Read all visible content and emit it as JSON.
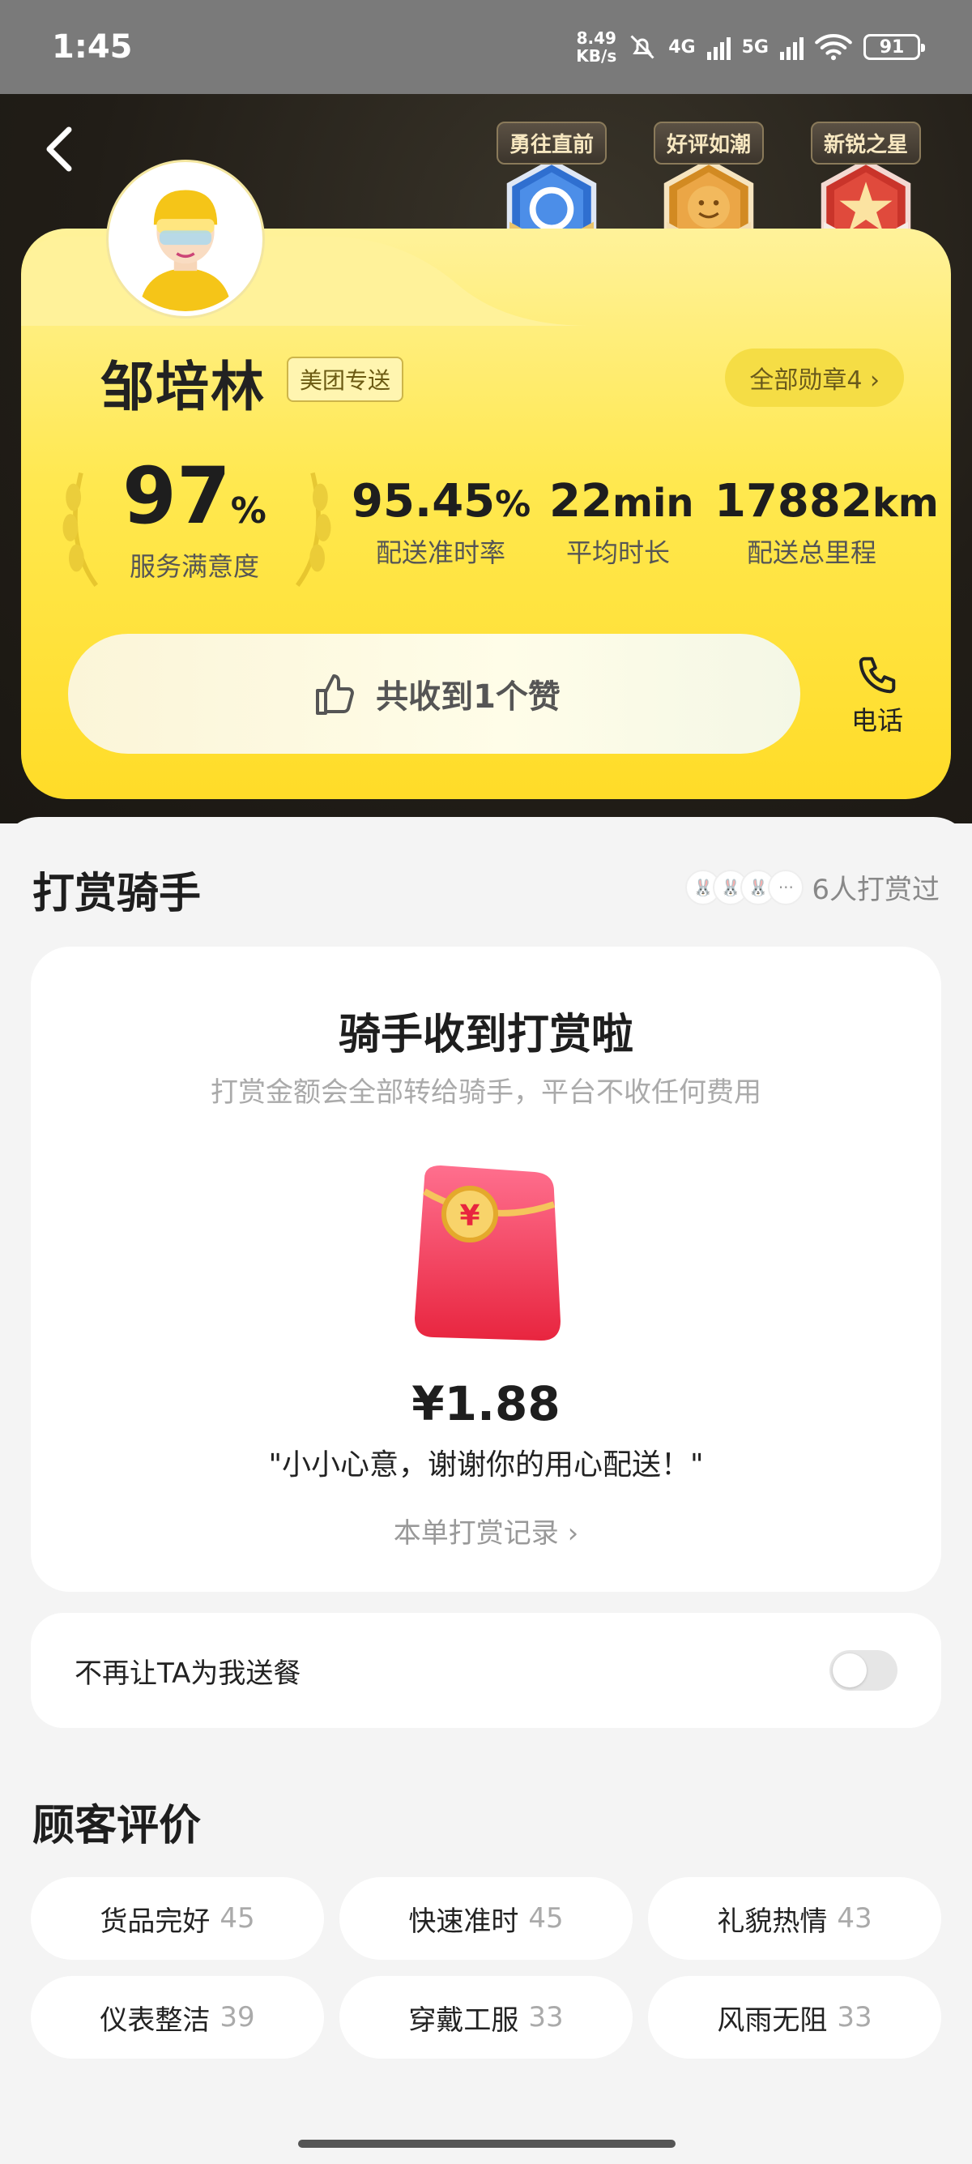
{
  "status_bar": {
    "time": "1:45",
    "speed_top": "8.49",
    "speed_bottom": "KB/s",
    "net1": "4G",
    "net2": "5G",
    "battery": "91"
  },
  "header": {
    "badges": [
      {
        "label": "勇往直前",
        "color": "#3f7fd6"
      },
      {
        "label": "好评如潮",
        "color": "#e5a83a"
      },
      {
        "label": "新锐之星",
        "color": "#d9463a"
      }
    ],
    "rider_name": "邹培林",
    "service_tag": "美团专送",
    "all_badges": "全部勋章4 ›"
  },
  "stats": [
    {
      "value": "97",
      "unit": "%",
      "label": "服务满意度"
    },
    {
      "value": "95.45",
      "unit": "%",
      "label": "配送准时率"
    },
    {
      "value": "22",
      "unit": "min",
      "label": "平均时长"
    },
    {
      "value": "17882",
      "unit": "km",
      "label": "配送总里程"
    }
  ],
  "likes": {
    "text": "共收到1个赞"
  },
  "phone": {
    "label": "电话"
  },
  "tip_section": {
    "title": "打赏骑手",
    "tippers_text": "6人打赏过",
    "card_title": "骑手收到打赏啦",
    "card_sub": "打赏金额会全部转给骑手，平台不收任何费用",
    "amount": "¥1.88",
    "message": "\"小小心意，谢谢你的用心配送！\"",
    "record_link": "本单打赏记录 ›"
  },
  "block_rider": {
    "label": "不再让TA为我送餐",
    "enabled": false
  },
  "reviews": {
    "title": "顾客评价",
    "tags": [
      {
        "label": "货品完好",
        "count": "45"
      },
      {
        "label": "快速准时",
        "count": "45"
      },
      {
        "label": "礼貌热情",
        "count": "43"
      },
      {
        "label": "仪表整洁",
        "count": "39"
      },
      {
        "label": "穿戴工服",
        "count": "33"
      },
      {
        "label": "风雨无阻",
        "count": "33"
      }
    ]
  },
  "colors": {
    "accent_yellow": "#ffe84f",
    "dark_bg": "#211d17"
  }
}
